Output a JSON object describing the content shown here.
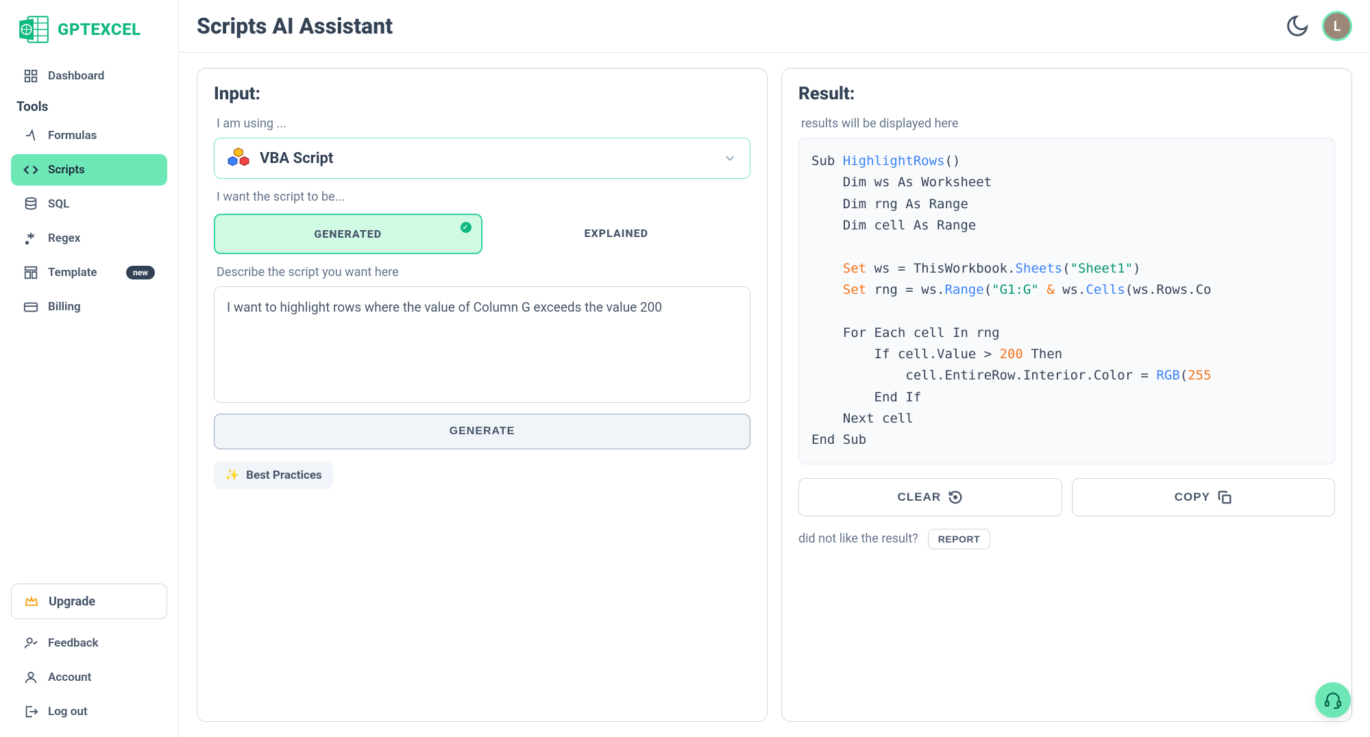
{
  "brand": {
    "name": "GPTEXCEL"
  },
  "header": {
    "title": "Scripts AI Assistant",
    "avatar_initial": "L"
  },
  "sidebar": {
    "dashboard": "Dashboard",
    "tools_label": "Tools",
    "items": [
      {
        "label": "Formulas"
      },
      {
        "label": "Scripts"
      },
      {
        "label": "SQL"
      },
      {
        "label": "Regex"
      },
      {
        "label": "Template",
        "badge": "new"
      },
      {
        "label": "Billing"
      }
    ],
    "upgrade": "Upgrade",
    "footer": [
      {
        "label": "Feedback"
      },
      {
        "label": "Account"
      },
      {
        "label": "Log out"
      }
    ]
  },
  "input_panel": {
    "title": "Input:",
    "using_label": "I am using ...",
    "select_value": "VBA Script",
    "want_label": "I want the script to be...",
    "toggle_generated": "GENERATED",
    "toggle_explained": "EXPLAINED",
    "describe_label": "Describe the script you want here",
    "description_value": "I want to highlight rows where the value of Column G exceeds the value 200",
    "generate_btn": "GENERATE",
    "best_practices": "Best Practices"
  },
  "result_panel": {
    "title": "Result:",
    "subtitle": "results will be displayed here",
    "code": {
      "l1a": "Sub ",
      "l1b": "HighlightRows",
      "l1c": "()",
      "l2": "    Dim ws As Worksheet",
      "l3": "    Dim rng As Range",
      "l4": "    Dim cell As Range",
      "l5a": "    ",
      "l5b": "Set",
      "l5c": " ws = ThisWorkbook.",
      "l5d": "Sheets",
      "l5e": "(",
      "l5f": "\"Sheet1\"",
      "l5g": ")",
      "l6a": "    ",
      "l6b": "Set",
      "l6c": " rng = ws.",
      "l6d": "Range",
      "l6e": "(",
      "l6f": "\"G1:G\"",
      "l6g": " & ",
      "l6h": "ws.",
      "l6i": "Cells",
      "l6j": "(ws.Rows.Co",
      "l7": "    For Each cell In rng",
      "l8a": "        If cell.Value > ",
      "l8b": "200",
      "l8c": " Then",
      "l9a": "            cell.EntireRow.Interior.Color = ",
      "l9b": "RGB",
      "l9c": "(",
      "l9d": "255",
      "l10": "        End If",
      "l11": "    Next cell",
      "l12": "End Sub"
    },
    "clear_btn": "CLEAR",
    "copy_btn": "COPY",
    "report_text": "did not like the result?",
    "report_btn": "REPORT"
  }
}
